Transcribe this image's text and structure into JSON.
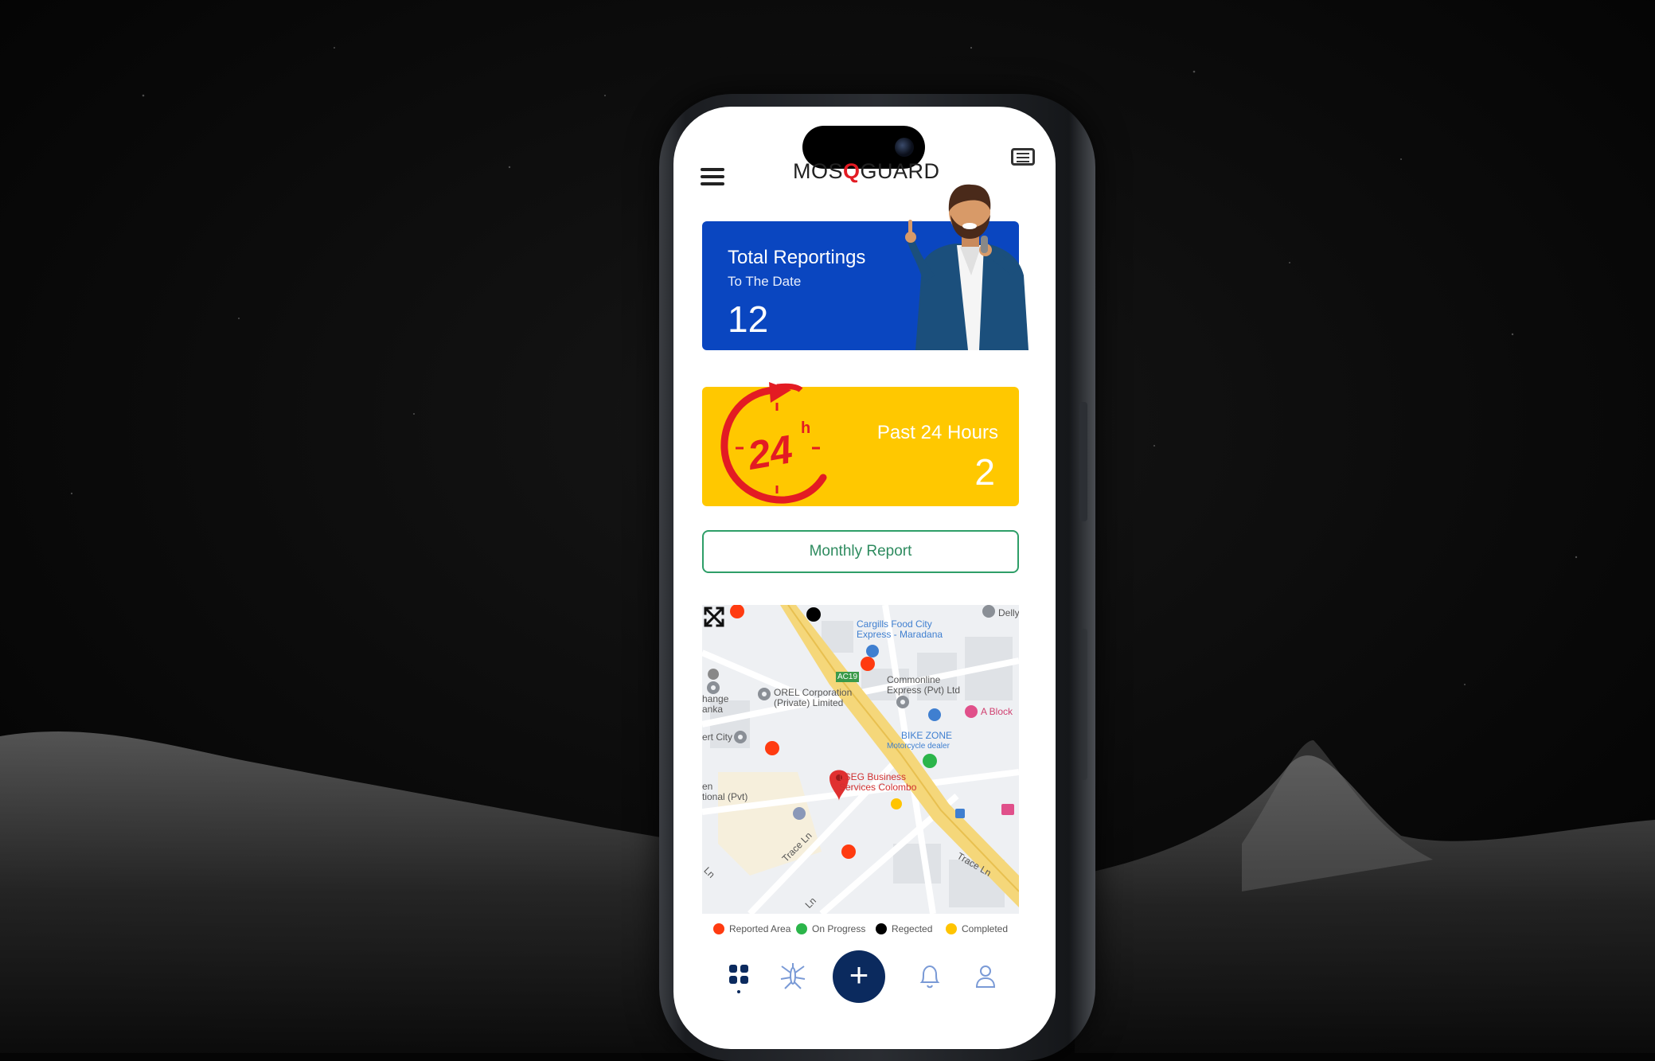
{
  "app": {
    "logo_left": "MOS",
    "logo_q": "Q",
    "logo_right": "GUARD"
  },
  "total_card": {
    "title": "Total Reportings",
    "subtitle": "To The Date",
    "value": "12",
    "color": "#0a46c0"
  },
  "past_card": {
    "badge": "24",
    "badge_sup": "h",
    "label": "Past 24 Hours",
    "value": "2",
    "color": "#ffc800"
  },
  "monthly_button": {
    "label": "Monthly Report"
  },
  "map": {
    "labels": {
      "cargills": "Cargills Food City",
      "cargills2": "Express - Maradana",
      "commonline": "Commonline",
      "commonline2": "Express (Pvt) Ltd",
      "orel": "OREL Corporation",
      "orel2": "(Private) Limited",
      "ablock": "A Block",
      "bikezone": "BIKE ZONE",
      "bikezone2": "Motorcycle dealer",
      "lseg": "LSEG Business",
      "lseg2": "Services Colombo",
      "road_ac19": "AC19",
      "change": "hange",
      "lanka": "anka",
      "city": "ert City",
      "en": "en",
      "tional": "tional (Pvt)",
      "trace1": "Trace Ln",
      "trace2": "Trace Ln",
      "ln1": "Ln",
      "ln2": "Ln",
      "delly": "Delly"
    }
  },
  "legend": [
    {
      "label": "Reported Area",
      "color": "#ff3b10"
    },
    {
      "label": "On Progress",
      "color": "#2bb54a"
    },
    {
      "label": "Regected",
      "color": "#000000"
    },
    {
      "label": "Completed",
      "color": "#ffc400"
    }
  ],
  "nav": {
    "fab_label": "+",
    "items": [
      "dashboard-icon",
      "mosquito-icon",
      "bell-icon",
      "user-icon"
    ]
  }
}
